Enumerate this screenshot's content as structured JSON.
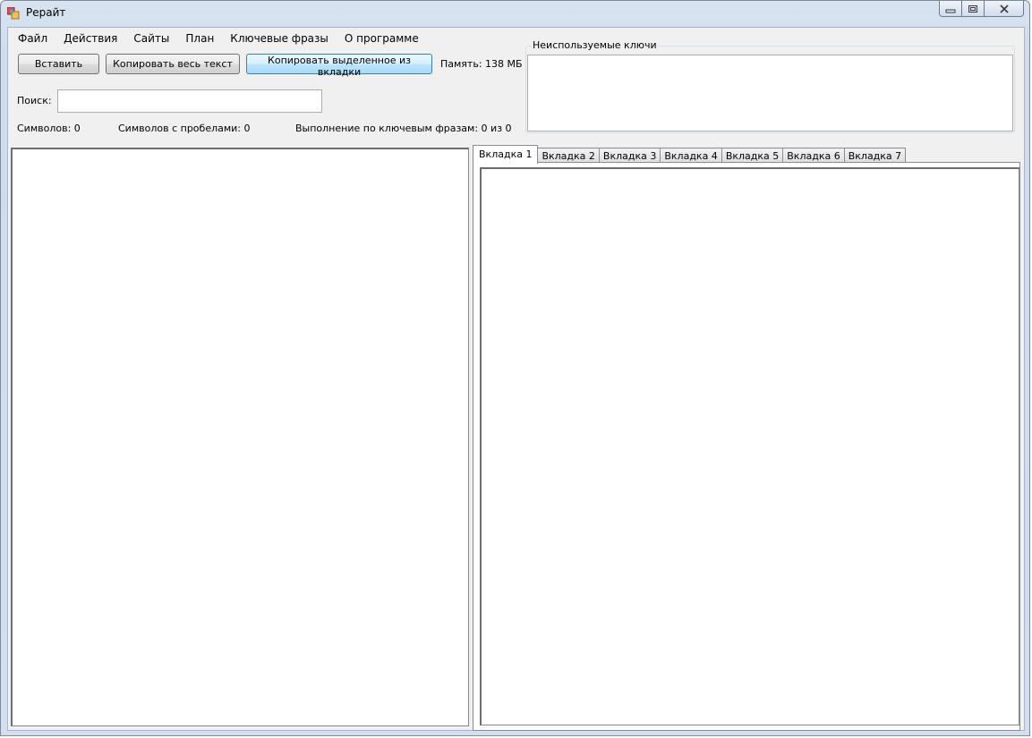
{
  "window": {
    "title": "Рерайт",
    "caption": {
      "minimize": "minimize",
      "maximize": "maximize",
      "close": "close"
    }
  },
  "menu": {
    "items": [
      "Файл",
      "Действия",
      "Сайты",
      "План",
      "Ключевые фразы",
      "О программе"
    ]
  },
  "toolbar": {
    "paste_label": "Вставить",
    "copy_all_label": "Копировать весь текст",
    "copy_selected_label": "Копировать выделенное из вкладки",
    "memory_label": "Память: 138 МБ"
  },
  "search": {
    "label": "Поиск:",
    "value": ""
  },
  "stats": {
    "chars_label": "Символов: 0",
    "chars_spaces_label": "Символов с пробелами: 0",
    "keyphrases_label": "Выполнение по ключевым фразам: 0 из 0"
  },
  "unused_keys": {
    "title": "Неиспользуемые ключи",
    "value": ""
  },
  "tabs": {
    "items": [
      "Вкладка 1",
      "Вкладка 2",
      "Вкладка 3",
      "Вкладка 4",
      "Вкладка 5",
      "Вкладка 6",
      "Вкладка 7"
    ],
    "active_index": 0
  },
  "editors": {
    "main_text": "",
    "tab_text": ""
  }
}
